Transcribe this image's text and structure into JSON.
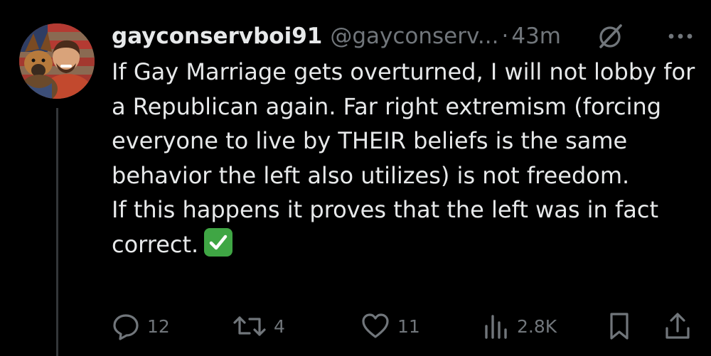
{
  "tweet": {
    "display_name": "gayconservboi91",
    "handle": "@gayconserv...",
    "separator": "·",
    "time_ago": "43m",
    "paragraphs": [
      "If Gay Marriage gets overturned, I will not lobby for a Republican again. Far right extremism (forcing everyone to live by THEIR beliefs is the same behavior the left also utilizes) is not freedom.",
      "If this happens it proves that the left was in fact correct."
    ],
    "emoji": "check-mark-button"
  },
  "actions": {
    "replies": "12",
    "reposts": "4",
    "likes": "11",
    "views": "2.8K"
  },
  "colors": {
    "background": "#000000",
    "text": "#e7e9ea",
    "muted": "#71767b",
    "check": "#3fa644"
  },
  "icons": [
    "grok-icon",
    "more-icon",
    "reply-icon",
    "repost-icon",
    "like-icon",
    "views-icon",
    "bookmark-icon",
    "share-icon"
  ]
}
